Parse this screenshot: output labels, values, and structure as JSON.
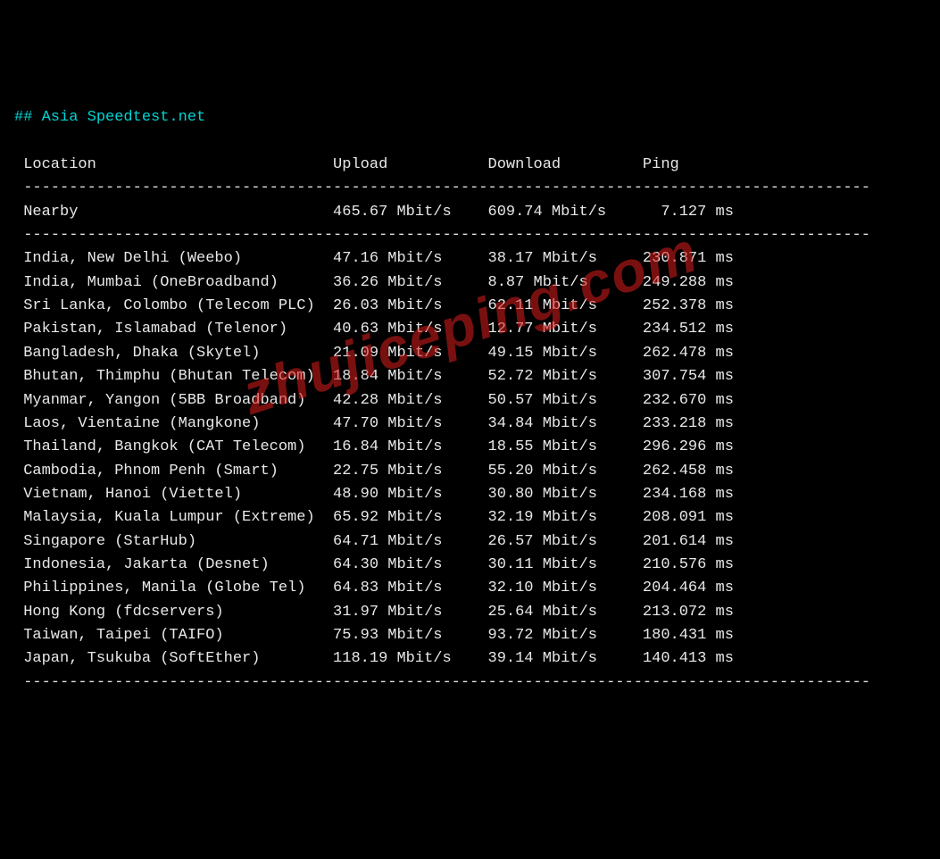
{
  "title": "## Asia Speedtest.net",
  "watermark": "zhujiceping.com",
  "headers": {
    "location": "Location",
    "upload": "Upload",
    "download": "Download",
    "ping": "Ping"
  },
  "nearby": {
    "location": "Nearby",
    "upload": "465.67 Mbit/s",
    "download": "609.74 Mbit/s",
    "ping": "7.127 ms"
  },
  "columns": {
    "loc_width": 34,
    "upload_width": 17,
    "download_width": 17,
    "ping_width": 12
  },
  "divider_len": 93,
  "rows": [
    {
      "location": "India, New Delhi (Weebo)",
      "upload": "47.16 Mbit/s",
      "download": "38.17 Mbit/s",
      "ping": "230.871 ms"
    },
    {
      "location": "India, Mumbai (OneBroadband)",
      "upload": "36.26 Mbit/s",
      "download": "8.87 Mbit/s",
      "ping": "249.288 ms"
    },
    {
      "location": "Sri Lanka, Colombo (Telecom PLC)",
      "upload": "26.03 Mbit/s",
      "download": "62.11 Mbit/s",
      "ping": "252.378 ms"
    },
    {
      "location": "Pakistan, Islamabad (Telenor)",
      "upload": "40.63 Mbit/s",
      "download": "12.77 Mbit/s",
      "ping": "234.512 ms"
    },
    {
      "location": "Bangladesh, Dhaka (Skytel)",
      "upload": "21.09 Mbit/s",
      "download": "49.15 Mbit/s",
      "ping": "262.478 ms"
    },
    {
      "location": "Bhutan, Thimphu (Bhutan Telecom)",
      "upload": "18.84 Mbit/s",
      "download": "52.72 Mbit/s",
      "ping": "307.754 ms"
    },
    {
      "location": "Myanmar, Yangon (5BB Broadband)",
      "upload": "42.28 Mbit/s",
      "download": "50.57 Mbit/s",
      "ping": "232.670 ms"
    },
    {
      "location": "Laos, Vientaine (Mangkone)",
      "upload": "47.70 Mbit/s",
      "download": "34.84 Mbit/s",
      "ping": "233.218 ms"
    },
    {
      "location": "Thailand, Bangkok (CAT Telecom)",
      "upload": "16.84 Mbit/s",
      "download": "18.55 Mbit/s",
      "ping": "296.296 ms"
    },
    {
      "location": "Cambodia, Phnom Penh (Smart)",
      "upload": "22.75 Mbit/s",
      "download": "55.20 Mbit/s",
      "ping": "262.458 ms"
    },
    {
      "location": "Vietnam, Hanoi (Viettel)",
      "upload": "48.90 Mbit/s",
      "download": "30.80 Mbit/s",
      "ping": "234.168 ms"
    },
    {
      "location": "Malaysia, Kuala Lumpur (Extreme)",
      "upload": "65.92 Mbit/s",
      "download": "32.19 Mbit/s",
      "ping": "208.091 ms"
    },
    {
      "location": "Singapore (StarHub)",
      "upload": "64.71 Mbit/s",
      "download": "26.57 Mbit/s",
      "ping": "201.614 ms"
    },
    {
      "location": "Indonesia, Jakarta (Desnet)",
      "upload": "64.30 Mbit/s",
      "download": "30.11 Mbit/s",
      "ping": "210.576 ms"
    },
    {
      "location": "Philippines, Manila (Globe Tel)",
      "upload": "64.83 Mbit/s",
      "download": "32.10 Mbit/s",
      "ping": "204.464 ms"
    },
    {
      "location": "Hong Kong (fdcservers)",
      "upload": "31.97 Mbit/s",
      "download": "25.64 Mbit/s",
      "ping": "213.072 ms"
    },
    {
      "location": "Taiwan, Taipei (TAIFO)",
      "upload": "75.93 Mbit/s",
      "download": "93.72 Mbit/s",
      "ping": "180.431 ms"
    },
    {
      "location": "Japan, Tsukuba (SoftEther)",
      "upload": "118.19 Mbit/s",
      "download": "39.14 Mbit/s",
      "ping": "140.413 ms"
    }
  ]
}
